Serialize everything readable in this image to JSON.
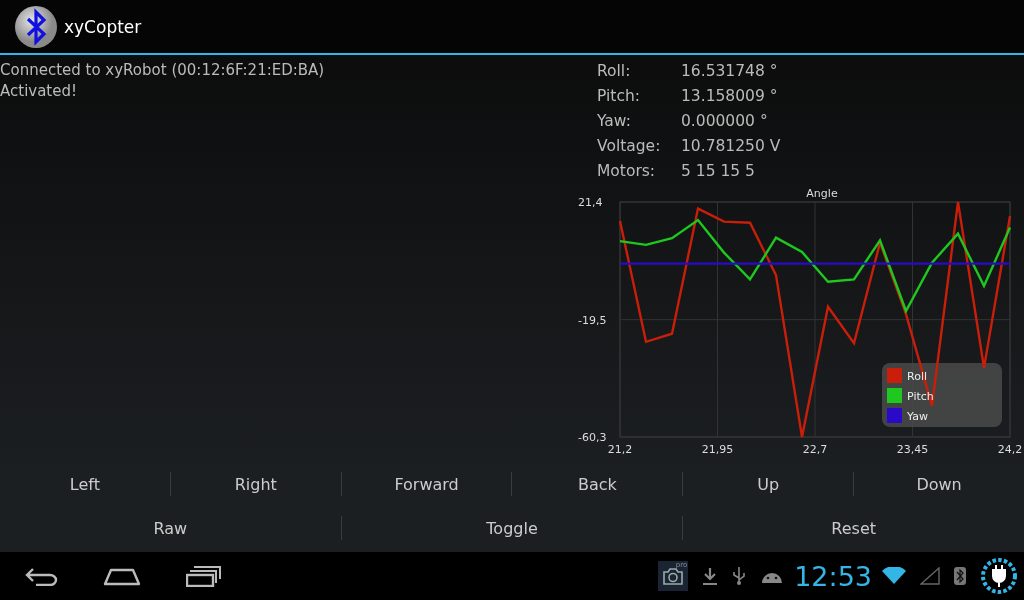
{
  "app_bar": {
    "title": "xyCopter"
  },
  "log": [
    "Connected to xyRobot (00:12:6F:21:ED:BA)",
    "Activated!"
  ],
  "telemetry": [
    {
      "label": "Roll:",
      "value": "16.531748 °"
    },
    {
      "label": "Pitch:",
      "value": "13.158009 °"
    },
    {
      "label": "Yaw:",
      "value": "0.000000 °"
    },
    {
      "label": "Voltage:",
      "value": "10.781250 V"
    },
    {
      "label": "Motors:",
      "value": "5 15 15 5"
    }
  ],
  "chart": {
    "chart_data": {
      "type": "line",
      "title": "Angle",
      "x": [
        21.2,
        21.4,
        21.6,
        21.8,
        22.0,
        22.2,
        22.4,
        22.6,
        22.8,
        23.0,
        23.2,
        23.4,
        23.6,
        23.8,
        24.0,
        24.2
      ],
      "series": [
        {
          "name": "Roll",
          "color": "#c81e0a",
          "values": [
            14.8,
            -27.2,
            -24.4,
            19.1,
            14.6,
            14.2,
            -4.0,
            -60.3,
            -15.0,
            -27.7,
            7.3,
            -17.6,
            -49.5,
            21.4,
            -36.2,
            16.5
          ]
        },
        {
          "name": "Pitch",
          "color": "#1ec81e",
          "values": [
            7.8,
            6.5,
            8.8,
            15.1,
            3.8,
            -5.5,
            9.0,
            4.0,
            -6.3,
            -5.5,
            8.1,
            -16.5,
            0.3,
            10.4,
            -7.8,
            12.5
          ]
        },
        {
          "name": "Yaw",
          "color": "#2a0ac8",
          "values": [
            0,
            0,
            0,
            0,
            0,
            0,
            0,
            0,
            0,
            0,
            0,
            0,
            0,
            0,
            0,
            0
          ]
        }
      ],
      "grid": true,
      "legend": true,
      "xlim": [
        21.2,
        24.2
      ],
      "ylim": [
        -60.3,
        21.4
      ],
      "xticks": [
        {
          "value": 21.2,
          "label": "21,2"
        },
        {
          "value": 21.95,
          "label": "21,95"
        },
        {
          "value": 22.7,
          "label": "22,7"
        },
        {
          "value": 23.45,
          "label": "23,45"
        },
        {
          "value": 24.2,
          "label": "24,2"
        }
      ],
      "yticks": [
        {
          "value": 21.4,
          "label": "21,4"
        },
        {
          "value": -19.5,
          "label": "-19,5"
        },
        {
          "value": -60.3,
          "label": "-60,3"
        }
      ]
    }
  },
  "control_buttons": [
    "Left",
    "Right",
    "Forward",
    "Back",
    "Up",
    "Down"
  ],
  "mode_buttons": [
    "Raw",
    "Toggle",
    "Reset"
  ],
  "status_bar": {
    "time": "12:53",
    "camera_badge": "pro"
  }
}
